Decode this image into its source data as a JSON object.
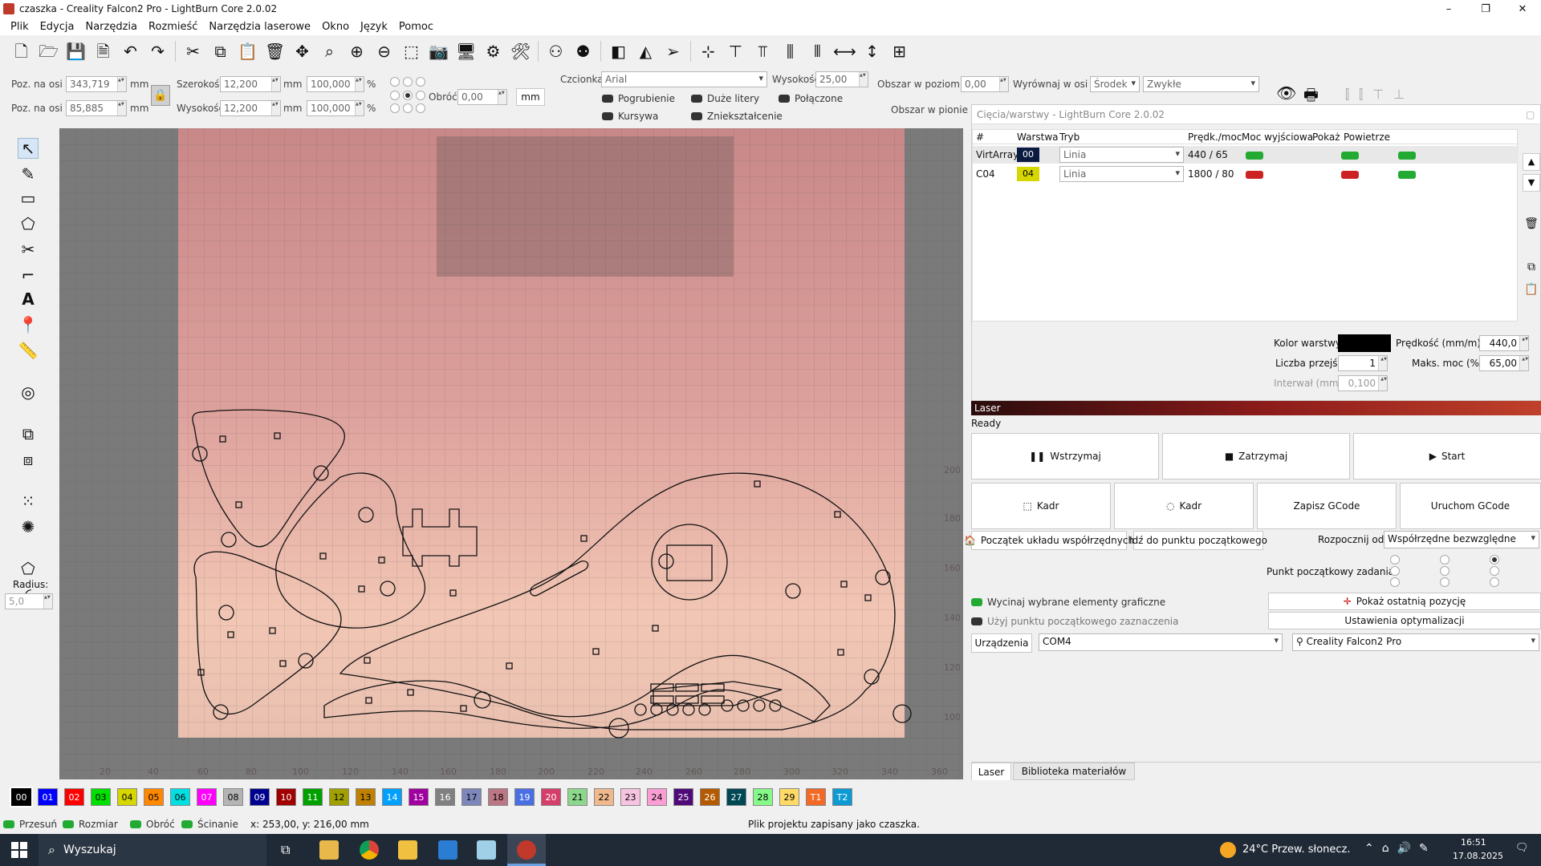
{
  "window": {
    "title": "czaszka - Creality Falcon2 Pro - LightBurn Core 2.0.02",
    "min": "–",
    "max": "❐",
    "close": "✕"
  },
  "menu": [
    "Plik",
    "Edycja",
    "Narzędzia",
    "Rozmieść",
    "Narzędzia laserowe",
    "Okno",
    "Język",
    "Pomoc"
  ],
  "props": {
    "posx_label": "Poz. na osi X",
    "posx": "343,719",
    "posy_label": "Poz. na osi Y",
    "posy": "85,885",
    "unit_mm": "mm",
    "width_label": "Szerokość",
    "width": "12,200",
    "height_label": "Wysokość",
    "height": "12,200",
    "scale_w": "100,000",
    "scale_h": "100,000",
    "pct": "%",
    "rotate_label": "Obróć",
    "rotate": "0,00",
    "mm_button": "mm",
    "font_label": "Czcionka",
    "font": "Arial",
    "fheight_label": "Wysokość",
    "fheight": "25,00",
    "bold": "Pogrubienie",
    "upper": "Duże litery",
    "welded": "Połączone",
    "italic": "Kursywa",
    "distort": "Zniekształcenie",
    "hspace_label": "Obszar w poziomie",
    "hspace": "0,00",
    "alignx_label": "Wyrównaj w osi X",
    "alignx": "Środek",
    "style": "Zwykłe",
    "vspace_label": "Obszar w pionie"
  },
  "left": {
    "radius_label": "Radius:",
    "radius": "5,0"
  },
  "palette": [
    {
      "l": "00",
      "c": "#000000",
      "t": "#ffffff"
    },
    {
      "l": "01",
      "c": "#0000ff",
      "t": "#ffffff"
    },
    {
      "l": "02",
      "c": "#ff0000",
      "t": "#ffffff"
    },
    {
      "l": "03",
      "c": "#00e000",
      "t": "#000000"
    },
    {
      "l": "04",
      "c": "#d6d600",
      "t": "#000000"
    },
    {
      "l": "05",
      "c": "#ff8800",
      "t": "#000000"
    },
    {
      "l": "06",
      "c": "#00e0e0",
      "t": "#000000"
    },
    {
      "l": "07",
      "c": "#ff00ff",
      "t": "#ffffff"
    },
    {
      "l": "08",
      "c": "#b4b4b4",
      "t": "#000000"
    },
    {
      "l": "09",
      "c": "#000090",
      "t": "#ffffff"
    },
    {
      "l": "10",
      "c": "#a00000",
      "t": "#ffffff"
    },
    {
      "l": "11",
      "c": "#00a000",
      "t": "#ffffff"
    },
    {
      "l": "12",
      "c": "#a0a000",
      "t": "#000000"
    },
    {
      "l": "13",
      "c": "#c08000",
      "t": "#000000"
    },
    {
      "l": "14",
      "c": "#00a0ff",
      "t": "#ffffff"
    },
    {
      "l": "15",
      "c": "#a000a0",
      "t": "#ffffff"
    },
    {
      "l": "16",
      "c": "#808080",
      "t": "#ffffff"
    },
    {
      "l": "17",
      "c": "#7d87b9",
      "t": "#000000"
    },
    {
      "l": "18",
      "c": "#bb7784",
      "t": "#000000"
    },
    {
      "l": "19",
      "c": "#4a6fe3",
      "t": "#ffffff"
    },
    {
      "l": "20",
      "c": "#d33f6a",
      "t": "#ffffff"
    },
    {
      "l": "21",
      "c": "#8cd78c",
      "t": "#000000"
    },
    {
      "l": "22",
      "c": "#f0b98d",
      "t": "#000000"
    },
    {
      "l": "23",
      "c": "#f6c4e1",
      "t": "#000000"
    },
    {
      "l": "24",
      "c": "#fa9ed4",
      "t": "#000000"
    },
    {
      "l": "25",
      "c": "#500a78",
      "t": "#ffffff"
    },
    {
      "l": "26",
      "c": "#b45a00",
      "t": "#ffffff"
    },
    {
      "l": "27",
      "c": "#004754",
      "t": "#ffffff"
    },
    {
      "l": "28",
      "c": "#86fa88",
      "t": "#000000"
    },
    {
      "l": "29",
      "c": "#ffdb66",
      "t": "#000000"
    },
    {
      "l": "T1",
      "c": "#f36926",
      "t": "#ffffff"
    },
    {
      "l": "T2",
      "c": "#0c9ad2",
      "t": "#ffffff"
    }
  ],
  "status": {
    "move": "Przesuń",
    "size": "Rozmiar",
    "rotate": "Obróć",
    "shear": "Ścinanie",
    "coords": "x: 253,00, y: 216,00 mm",
    "message": "Plik projektu zapisany jako czaszka."
  },
  "cuts": {
    "title": "Cięcia/warstwy - LightBurn Core 2.0.02",
    "headers": [
      "#",
      "Warstwa",
      "Tryb",
      "Prędk./moc",
      "Moc wyjściowa",
      "Pokaż",
      "Powietrze"
    ],
    "rows": [
      {
        "name": "VirtArray",
        "layer": "00",
        "color": "#0a1a40",
        "tcolor": "#ffffff",
        "mode": "Linia",
        "speed": "440 / 65",
        "out": "green",
        "show": "green",
        "air": "green"
      },
      {
        "name": "C04",
        "layer": "04",
        "color": "#d6d600",
        "tcolor": "#000000",
        "mode": "Linia",
        "speed": "1800 / 80",
        "out": "red",
        "show": "red",
        "air": "green"
      }
    ],
    "layer_color_label": "Kolor warstwy",
    "speed_label": "Prędkość (mm/m)",
    "speed": "440,0",
    "passes_label": "Liczba przejść",
    "passes": "1",
    "maxpower_label": "Maks. moc (%)",
    "maxpower": "65,00",
    "interval_label": "Interwał (mm)",
    "interval": "0,100"
  },
  "laser": {
    "title": "Laser",
    "state": "Ready",
    "pause": "Wstrzymaj",
    "stop": "Zatrzymaj",
    "start": "Start",
    "frame1": "Kadr",
    "frame2": "Kadr",
    "save_gcode": "Zapisz GCode",
    "run_gcode": "Uruchom GCode",
    "origin": "Początek układu współrzędnych",
    "goto_origin": "Idź do punktu początkowego",
    "start_from_label": "Rozpocznij od:",
    "start_from": "Współrzędne bezwzględne",
    "job_origin_label": "Punkt początkowy zadania",
    "cut_selected": "Wycinaj wybrane elementy graficzne",
    "use_selection_origin": "Użyj punktu początkowego zaznaczenia",
    "show_last": "Pokaż ostatnią pozycję",
    "optimize": "Ustawienia optymalizacji",
    "devices": "Urządzenia",
    "port": "COM4",
    "device": "Creality Falcon2 Pro",
    "tabs": [
      "Laser",
      "Biblioteka materiałów"
    ]
  },
  "taskbar": {
    "search": "Wyszukaj",
    "weather": "24°C  Przew. słonecz.",
    "time": "16:51",
    "date": "17.08.2025"
  },
  "ruler": {
    "x": [
      "20",
      "40",
      "60",
      "80",
      "100",
      "120",
      "140",
      "160",
      "180",
      "200",
      "220",
      "240",
      "260",
      "280",
      "300",
      "320",
      "340",
      "360"
    ],
    "y": [
      "200",
      "180",
      "160",
      "140",
      "120",
      "100"
    ]
  }
}
